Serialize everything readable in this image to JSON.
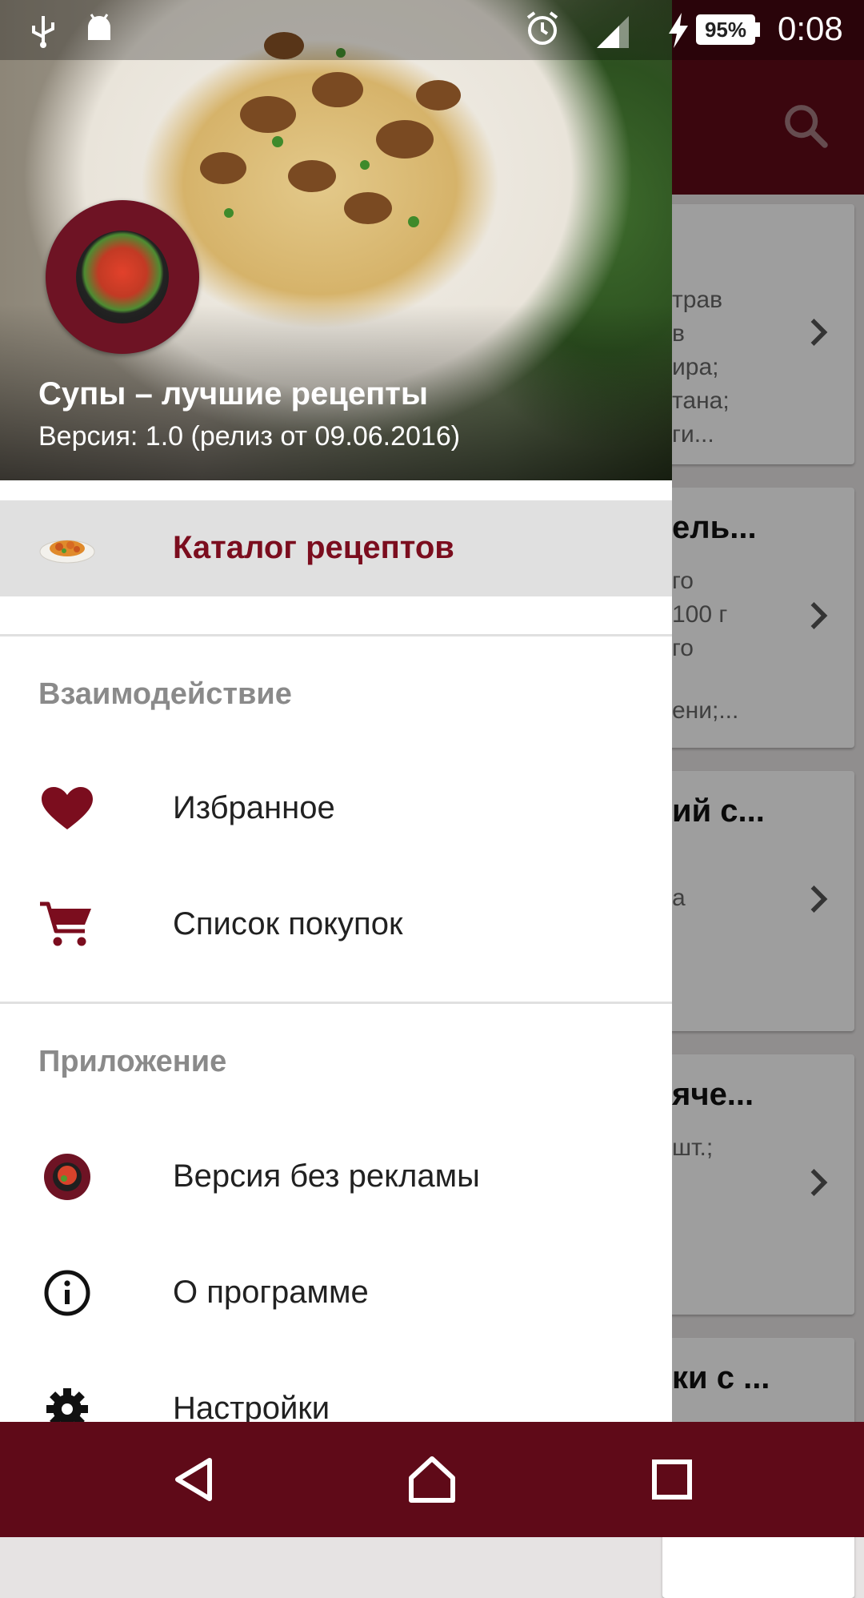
{
  "status_bar": {
    "battery": "95%",
    "time": "0:08",
    "icons": [
      "usb-icon",
      "android-debug-icon",
      "alarm-icon",
      "signal-icon",
      "charging-icon",
      "battery-icon"
    ]
  },
  "background": {
    "cards": [
      {
        "title": "",
        "lines": [
          "трав",
          "в",
          "ира;",
          "тана;",
          "ги..."
        ]
      },
      {
        "title": "ель...",
        "lines": [
          "го",
          "100 г",
          "го",
          "",
          "ени;..."
        ]
      },
      {
        "title": "ий с...",
        "lines": [
          "",
          "а"
        ]
      },
      {
        "title": "яче...",
        "lines": [
          "шт.;"
        ]
      },
      {
        "title": "ки с ...",
        "lines": []
      }
    ]
  },
  "drawer": {
    "header": {
      "title": "Супы – лучшие рецепты",
      "subtitle": "Версия: 1.0 (релиз от 09.06.2016)"
    },
    "catalog": {
      "label": "Каталог рецептов"
    },
    "section_interaction": "Взаимодействие",
    "favorites": {
      "label": "Избранное"
    },
    "shopping": {
      "label": "Список покупок"
    },
    "section_app": "Приложение",
    "no_ads": {
      "label": "Версия без рекламы"
    },
    "about": {
      "label": "О программе"
    },
    "settings": {
      "label": "Настройки"
    }
  },
  "colors": {
    "brand": "#5f0a18",
    "accent": "#7b0d1e",
    "selected_bg": "#e0e0e0"
  }
}
